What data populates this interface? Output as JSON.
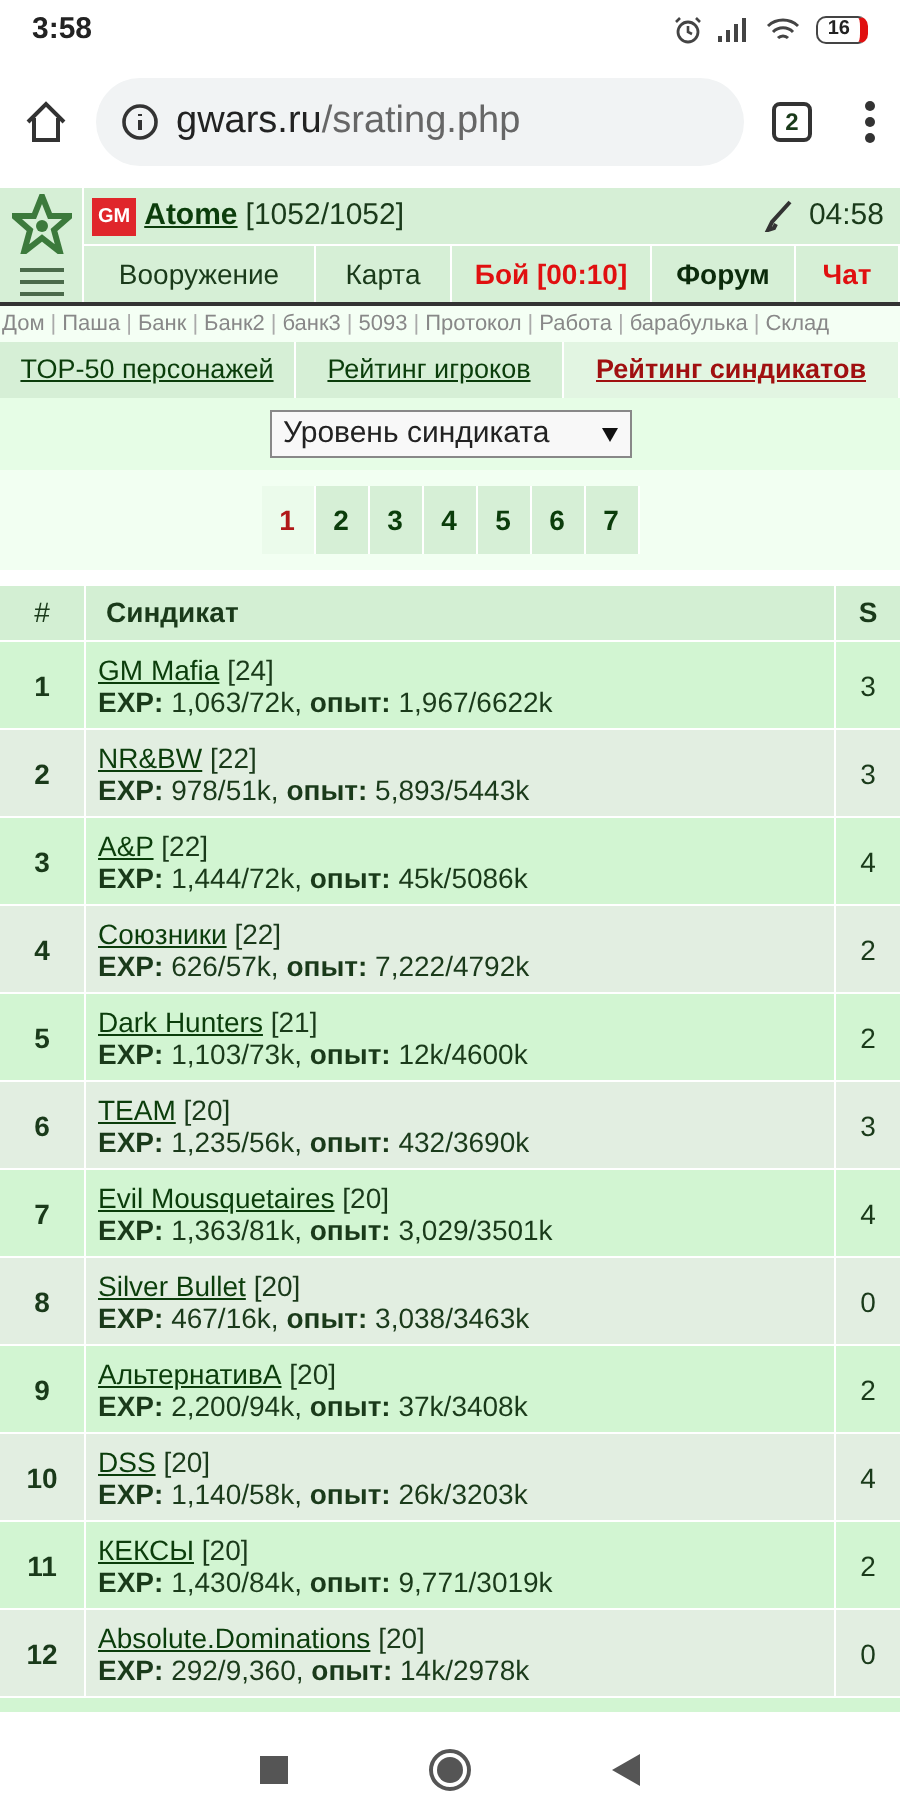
{
  "status_bar": {
    "time": "3:58",
    "battery": "16"
  },
  "browser": {
    "url_host": "gwars.ru",
    "url_path": "/srating.php",
    "tab_count": "2"
  },
  "header": {
    "badge": "GM",
    "player": "Atome",
    "hp": "[1052/1052]",
    "clock": "04:58"
  },
  "nav": [
    {
      "label": "Вооружение",
      "kind": "normal"
    },
    {
      "label": "Карта",
      "kind": "normal"
    },
    {
      "label": "Бой [00:10]",
      "kind": "alert"
    },
    {
      "label": "Форум",
      "kind": "strong"
    },
    {
      "label": "Чат",
      "kind": "alert"
    }
  ],
  "quick_links": [
    "Дом",
    "Паша",
    "Банк",
    "Банк2",
    "банк3",
    "5093",
    "Протокол",
    "Работа",
    "барабулька",
    "Склад"
  ],
  "link_separator": "|",
  "tabs": [
    {
      "label": "TOP-50 персонажей",
      "selected": false
    },
    {
      "label": "Рейтинг игроков",
      "selected": false
    },
    {
      "label": "Рейтинг синдикатов",
      "selected": true
    }
  ],
  "sort_select": {
    "value": "Уровень синдиката"
  },
  "pages": [
    {
      "label": "1",
      "selected": true
    },
    {
      "label": "2",
      "selected": false
    },
    {
      "label": "3",
      "selected": false
    },
    {
      "label": "4",
      "selected": false
    },
    {
      "label": "5",
      "selected": false
    },
    {
      "label": "6",
      "selected": false
    },
    {
      "label": "7",
      "selected": false
    }
  ],
  "table": {
    "columns": [
      "#",
      "Синдикат",
      "S"
    ],
    "rows": [
      {
        "rank": "1",
        "name": "GM Mafia",
        "level": "[24]",
        "stats": "**EXP:** 1,063/72k, **опыт:** 1,967/6622k",
        "s": "3"
      },
      {
        "rank": "2",
        "name": "NR&BW",
        "level": "[22]",
        "stats": "**EXP:** 978/51k, **опыт:** 5,893/5443k",
        "s": "3"
      },
      {
        "rank": "3",
        "name": "A&P",
        "level": "[22]",
        "stats": "**EXP:** 1,444/72k, **опыт:** 45k/5086k",
        "s": "4"
      },
      {
        "rank": "4",
        "name": "Союзники",
        "level": "[22]",
        "stats": "**EXP:** 626/57k, **опыт:** 7,222/4792k",
        "s": "2"
      },
      {
        "rank": "5",
        "name": "Dark Hunters",
        "level": "[21]",
        "stats": "**EXP:** 1,103/73k, **опыт:** 12k/4600k",
        "s": "2"
      },
      {
        "rank": "6",
        "name": "TEAM",
        "level": "[20]",
        "stats": "**EXP:** 1,235/56k, **опыт:** 432/3690k",
        "s": "3"
      },
      {
        "rank": "7",
        "name": "Evil Mousquetaires",
        "level": "[20]",
        "stats": "**EXP:** 1,363/81k, **опыт:** 3,029/3501k",
        "s": "4"
      },
      {
        "rank": "8",
        "name": "Silver Bullet",
        "level": "[20]",
        "stats": "**EXP:** 467/16k, **опыт:** 3,038/3463k",
        "s": "0"
      },
      {
        "rank": "9",
        "name": "АльтернативА",
        "level": "[20]",
        "stats": "**EXP:** 2,200/94k, **опыт:** 37k/3408k",
        "s": "2"
      },
      {
        "rank": "10",
        "name": "DSS",
        "level": "[20]",
        "stats": "**EXP:** 1,140/58k, **опыт:** 26k/3203k",
        "s": "4"
      },
      {
        "rank": "11",
        "name": "КЕКСЫ",
        "level": "[20]",
        "stats": "**EXP:** 1,430/84k, **опыт:** 9,771/3019k",
        "s": "2"
      },
      {
        "rank": "12",
        "name": "Absolute.Dominations",
        "level": "[20]",
        "stats": "**EXP:** 292/9,360, **опыт:** 14k/2978k",
        "s": "0"
      }
    ]
  }
}
